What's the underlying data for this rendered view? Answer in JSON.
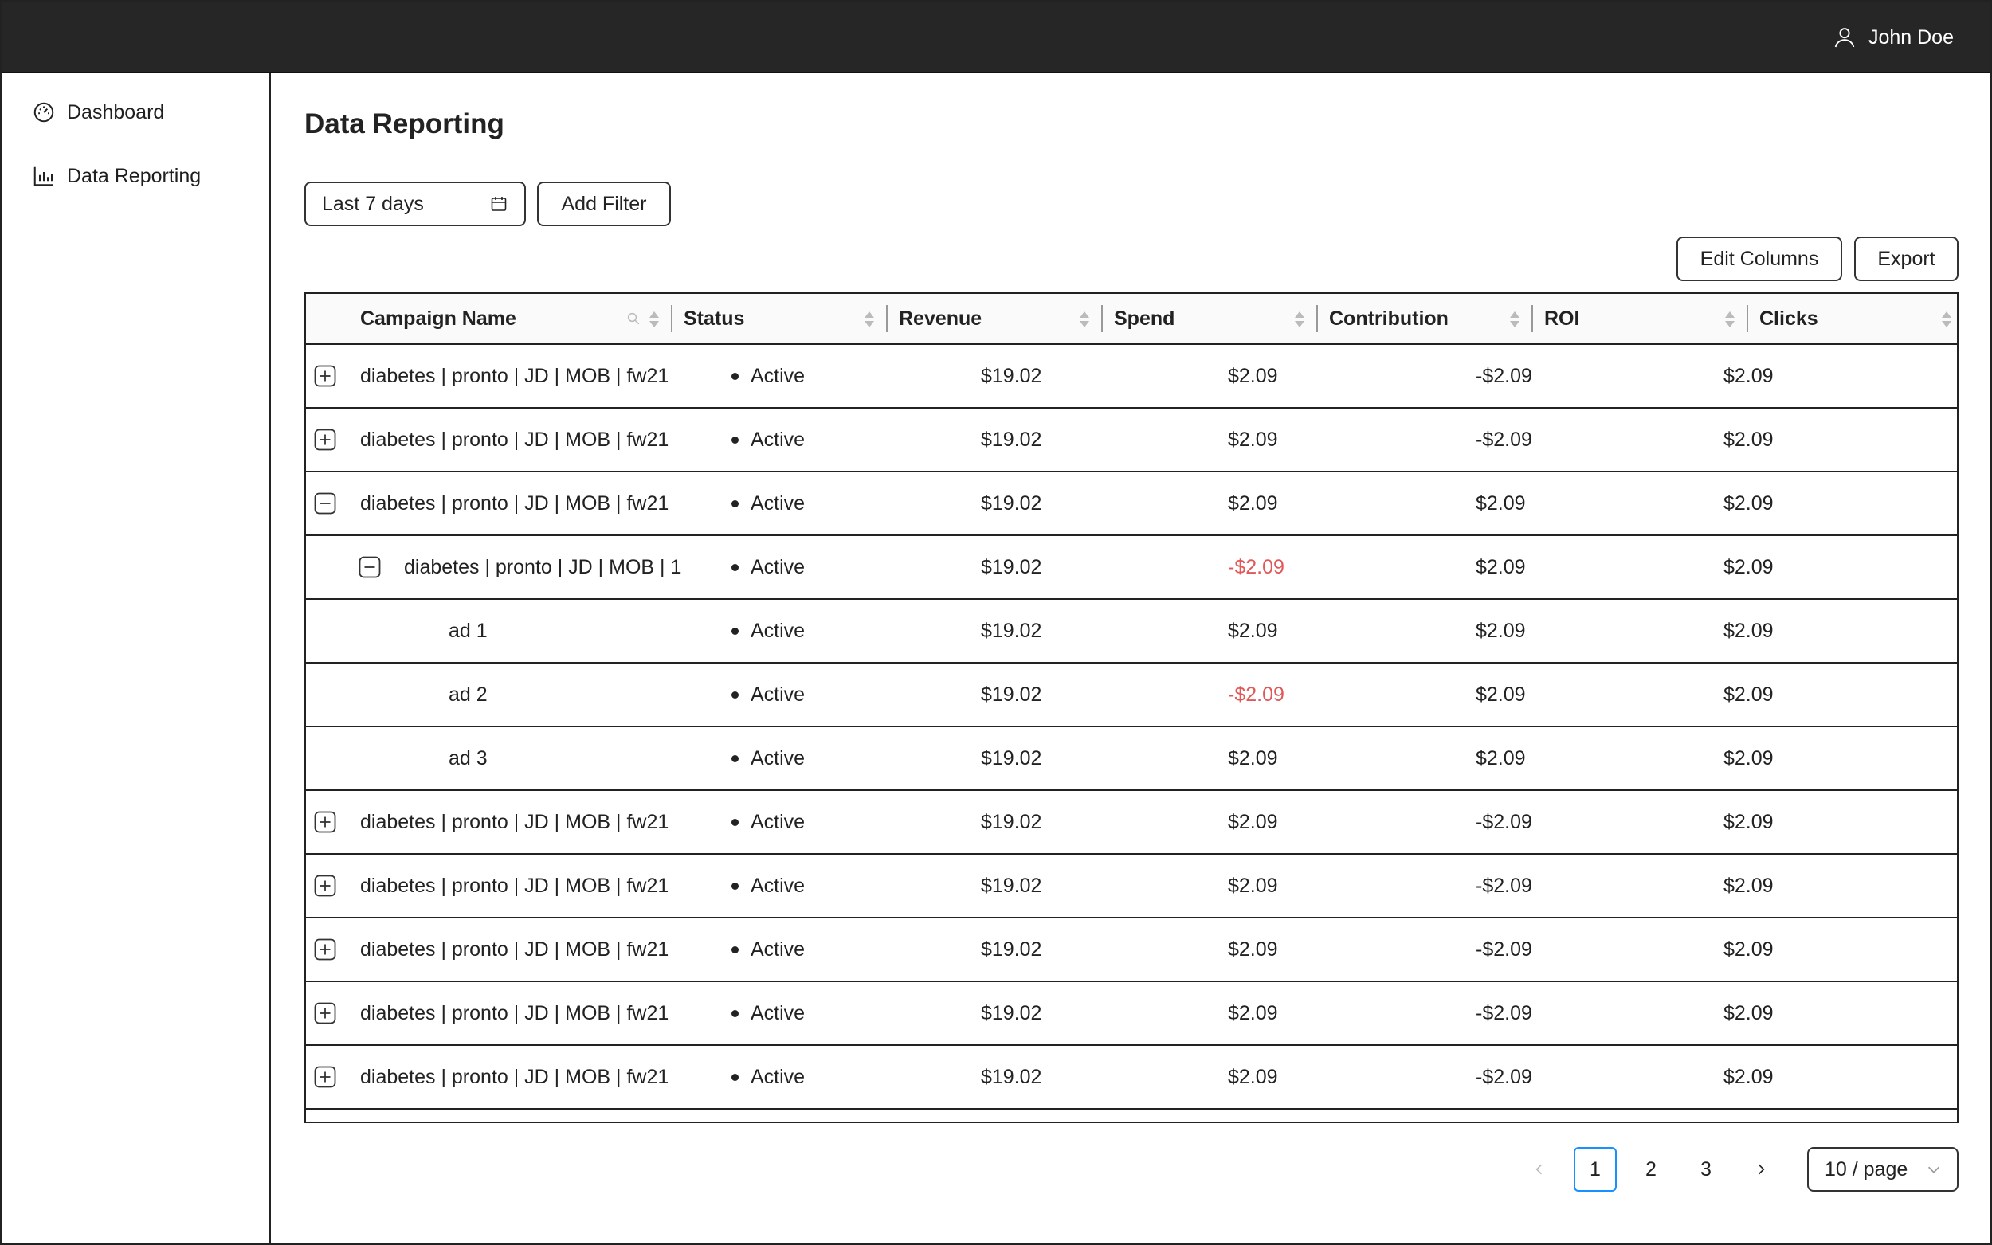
{
  "topbar": {
    "user_name": "John Doe",
    "user_icon": "user-icon"
  },
  "sidebar": {
    "items": [
      {
        "label": "Dashboard",
        "icon": "dashboard-icon"
      },
      {
        "label": "Data Reporting",
        "icon": "bar-chart-icon"
      }
    ]
  },
  "page": {
    "title": "Data Reporting"
  },
  "toolbar": {
    "date_range": "Last 7 days",
    "add_filter": "Add Filter",
    "edit_columns": "Edit Columns",
    "export": "Export"
  },
  "table": {
    "columns": [
      "Campaign Name",
      "Status",
      "Revenue",
      "Spend",
      "Contribution",
      "ROI",
      "Clicks"
    ],
    "rows": [
      {
        "name": "diabetes | pronto | JD | MOB | fw21",
        "level": 0,
        "expander": "plus",
        "status": "Active",
        "revenue": "$19.02",
        "spend": "$2.09",
        "spend_negative": false,
        "contribution": "-$2.09",
        "roi": "$2.09"
      },
      {
        "name": "diabetes | pronto | JD | MOB | fw21",
        "level": 0,
        "expander": "plus",
        "status": "Active",
        "revenue": "$19.02",
        "spend": "$2.09",
        "spend_negative": false,
        "contribution": "-$2.09",
        "roi": "$2.09"
      },
      {
        "name": "diabetes | pronto | JD | MOB | fw21",
        "level": 0,
        "expander": "minus",
        "status": "Active",
        "revenue": "$19.02",
        "spend": "$2.09",
        "spend_negative": false,
        "contribution": "$2.09",
        "roi": "$2.09"
      },
      {
        "name": "diabetes | pronto | JD | MOB | 1",
        "level": 1,
        "expander": "minus",
        "status": "Active",
        "revenue": "$19.02",
        "spend": "-$2.09",
        "spend_negative": true,
        "contribution": "$2.09",
        "roi": "$2.09"
      },
      {
        "name": "ad 1",
        "level": 2,
        "expander": "none",
        "status": "Active",
        "revenue": "$19.02",
        "spend": "$2.09",
        "spend_negative": false,
        "contribution": "$2.09",
        "roi": "$2.09"
      },
      {
        "name": "ad 2",
        "level": 2,
        "expander": "none",
        "status": "Active",
        "revenue": "$19.02",
        "spend": "-$2.09",
        "spend_negative": true,
        "contribution": "$2.09",
        "roi": "$2.09"
      },
      {
        "name": "ad 3",
        "level": 2,
        "expander": "none",
        "status": "Active",
        "revenue": "$19.02",
        "spend": "$2.09",
        "spend_negative": false,
        "contribution": "$2.09",
        "roi": "$2.09"
      },
      {
        "name": "diabetes | pronto | JD | MOB | fw21",
        "level": 0,
        "expander": "plus",
        "status": "Active",
        "revenue": "$19.02",
        "spend": "$2.09",
        "spend_negative": false,
        "contribution": "-$2.09",
        "roi": "$2.09"
      },
      {
        "name": "diabetes | pronto | JD | MOB | fw21",
        "level": 0,
        "expander": "plus",
        "status": "Active",
        "revenue": "$19.02",
        "spend": "$2.09",
        "spend_negative": false,
        "contribution": "-$2.09",
        "roi": "$2.09"
      },
      {
        "name": "diabetes | pronto | JD | MOB | fw21",
        "level": 0,
        "expander": "plus",
        "status": "Active",
        "revenue": "$19.02",
        "spend": "$2.09",
        "spend_negative": false,
        "contribution": "-$2.09",
        "roi": "$2.09"
      },
      {
        "name": "diabetes | pronto | JD | MOB | fw21",
        "level": 0,
        "expander": "plus",
        "status": "Active",
        "revenue": "$19.02",
        "spend": "$2.09",
        "spend_negative": false,
        "contribution": "-$2.09",
        "roi": "$2.09"
      },
      {
        "name": "diabetes | pronto | JD | MOB | fw21",
        "level": 0,
        "expander": "plus",
        "status": "Active",
        "revenue": "$19.02",
        "spend": "$2.09",
        "spend_negative": false,
        "contribution": "-$2.09",
        "roi": "$2.09"
      }
    ]
  },
  "pagination": {
    "pages": [
      "1",
      "2",
      "3"
    ],
    "current": "1",
    "page_size": "10 / page"
  },
  "colors": {
    "topbar": "#262626",
    "negative": "#e05858",
    "active_page": "#1890ff"
  }
}
